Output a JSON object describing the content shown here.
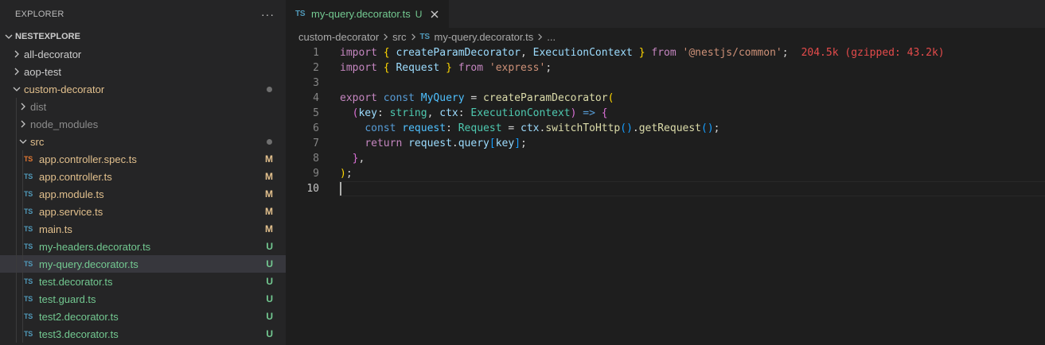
{
  "explorer": {
    "title": "EXPLORER",
    "more_icon": "ellipsis-icon",
    "section": "NESTEXPLORE",
    "items": [
      {
        "label": "all-decorator",
        "kind": "folder",
        "expanded": false,
        "depth": 0
      },
      {
        "label": "aop-test",
        "kind": "folder",
        "expanded": false,
        "depth": 0
      },
      {
        "label": "custom-decorator",
        "kind": "folder",
        "expanded": true,
        "depth": 0,
        "decoration": "dot"
      },
      {
        "label": "dist",
        "kind": "folder",
        "expanded": false,
        "depth": 1
      },
      {
        "label": "node_modules",
        "kind": "folder",
        "expanded": false,
        "depth": 1
      },
      {
        "label": "src",
        "kind": "folder",
        "expanded": true,
        "depth": 1,
        "decoration": "dot"
      },
      {
        "label": "app.controller.spec.ts",
        "kind": "file",
        "icon": "TS",
        "icon_color": "#e37933",
        "badge": "M",
        "badge_color": "#e2c08d",
        "depth": 2
      },
      {
        "label": "app.controller.ts",
        "kind": "file",
        "icon": "TS",
        "badge": "M",
        "depth": 2
      },
      {
        "label": "app.module.ts",
        "kind": "file",
        "icon": "TS",
        "badge": "M",
        "depth": 2
      },
      {
        "label": "app.service.ts",
        "kind": "file",
        "icon": "TS",
        "badge": "M",
        "depth": 2
      },
      {
        "label": "main.ts",
        "kind": "file",
        "icon": "TS",
        "badge": "M",
        "depth": 2
      },
      {
        "label": "my-headers.decorator.ts",
        "kind": "file",
        "icon": "TS",
        "badge": "U",
        "depth": 2
      },
      {
        "label": "my-query.decorator.ts",
        "kind": "file",
        "icon": "TS",
        "badge": "U",
        "depth": 2,
        "selected": true
      },
      {
        "label": "test.decorator.ts",
        "kind": "file",
        "icon": "TS",
        "badge": "U",
        "depth": 2
      },
      {
        "label": "test.guard.ts",
        "kind": "file",
        "icon": "TS",
        "badge": "U",
        "depth": 2
      },
      {
        "label": "test2.decorator.ts",
        "kind": "file",
        "icon": "TS",
        "badge": "U",
        "depth": 2
      },
      {
        "label": "test3.decorator.ts",
        "kind": "file",
        "icon": "TS",
        "badge": "U",
        "depth": 2
      }
    ]
  },
  "tab": {
    "icon": "TS",
    "title": "my-query.decorator.ts",
    "status": "U",
    "close_icon": "close-icon"
  },
  "breadcrumb": {
    "items": [
      "custom-decorator",
      "src",
      "my-query.decorator.ts",
      "..."
    ],
    "file_icon": "TS"
  },
  "code": {
    "active_line": 10,
    "import_cost_hint": "204.5k (gzipped: 43.2k)",
    "lines": [
      [
        [
          "k-purple",
          "import"
        ],
        [
          "k-plain",
          " "
        ],
        [
          "k-gold",
          "{"
        ],
        [
          "k-plain",
          " "
        ],
        [
          "k-var",
          "createParamDecorator"
        ],
        [
          "k-plain",
          ", "
        ],
        [
          "k-var",
          "ExecutionContext"
        ],
        [
          "k-plain",
          " "
        ],
        [
          "k-gold",
          "}"
        ],
        [
          "k-plain",
          " "
        ],
        [
          "k-purple",
          "from"
        ],
        [
          "k-plain",
          " "
        ],
        [
          "k-str",
          "'@nestjs/common'"
        ],
        [
          "k-plain",
          ";"
        ]
      ],
      [
        [
          "k-purple",
          "import"
        ],
        [
          "k-plain",
          " "
        ],
        [
          "k-gold",
          "{"
        ],
        [
          "k-plain",
          " "
        ],
        [
          "k-var",
          "Request"
        ],
        [
          "k-plain",
          " "
        ],
        [
          "k-gold",
          "}"
        ],
        [
          "k-plain",
          " "
        ],
        [
          "k-purple",
          "from"
        ],
        [
          "k-plain",
          " "
        ],
        [
          "k-str",
          "'express'"
        ],
        [
          "k-plain",
          ";"
        ]
      ],
      [],
      [
        [
          "k-purple",
          "export"
        ],
        [
          "k-plain",
          " "
        ],
        [
          "k-blue",
          "const"
        ],
        [
          "k-plain",
          " "
        ],
        [
          "k-const",
          "MyQuery"
        ],
        [
          "k-plain",
          " = "
        ],
        [
          "k-fn",
          "createParamDecorator"
        ],
        [
          "k-gold",
          "("
        ]
      ],
      [
        [
          "k-plain",
          "  "
        ],
        [
          "k-violet",
          "("
        ],
        [
          "k-var",
          "key"
        ],
        [
          "k-plain",
          ": "
        ],
        [
          "k-type",
          "string"
        ],
        [
          "k-plain",
          ", "
        ],
        [
          "k-var",
          "ctx"
        ],
        [
          "k-plain",
          ": "
        ],
        [
          "k-type",
          "ExecutionContext"
        ],
        [
          "k-violet",
          ")"
        ],
        [
          "k-plain",
          " "
        ],
        [
          "k-blue",
          "=>"
        ],
        [
          "k-plain",
          " "
        ],
        [
          "k-violet",
          "{"
        ]
      ],
      [
        [
          "k-plain",
          "    "
        ],
        [
          "k-blue",
          "const"
        ],
        [
          "k-plain",
          " "
        ],
        [
          "k-const",
          "request"
        ],
        [
          "k-plain",
          ": "
        ],
        [
          "k-type",
          "Request"
        ],
        [
          "k-plain",
          " = "
        ],
        [
          "k-var",
          "ctx"
        ],
        [
          "k-plain",
          "."
        ],
        [
          "k-fn",
          "switchToHttp"
        ],
        [
          "k-sky",
          "()"
        ],
        [
          "k-plain",
          "."
        ],
        [
          "k-fn",
          "getRequest"
        ],
        [
          "k-sky",
          "()"
        ],
        [
          "k-plain",
          ";"
        ]
      ],
      [
        [
          "k-plain",
          "    "
        ],
        [
          "k-purple",
          "return"
        ],
        [
          "k-plain",
          " "
        ],
        [
          "k-var",
          "request"
        ],
        [
          "k-plain",
          "."
        ],
        [
          "k-var",
          "query"
        ],
        [
          "k-sky",
          "["
        ],
        [
          "k-var",
          "key"
        ],
        [
          "k-sky",
          "]"
        ],
        [
          "k-plain",
          ";"
        ]
      ],
      [
        [
          "k-plain",
          "  "
        ],
        [
          "k-violet",
          "}"
        ],
        [
          "k-plain",
          ","
        ]
      ],
      [
        [
          "k-gold",
          ")"
        ],
        [
          "k-plain",
          ";"
        ]
      ],
      []
    ]
  },
  "colors": {
    "editor_bg": "#1e1e1e",
    "sidebar_bg": "#252526",
    "selected_bg": "#37373d",
    "untracked": "#73c991",
    "modified": "#e2c08d",
    "ts_icon": "#519aba"
  }
}
